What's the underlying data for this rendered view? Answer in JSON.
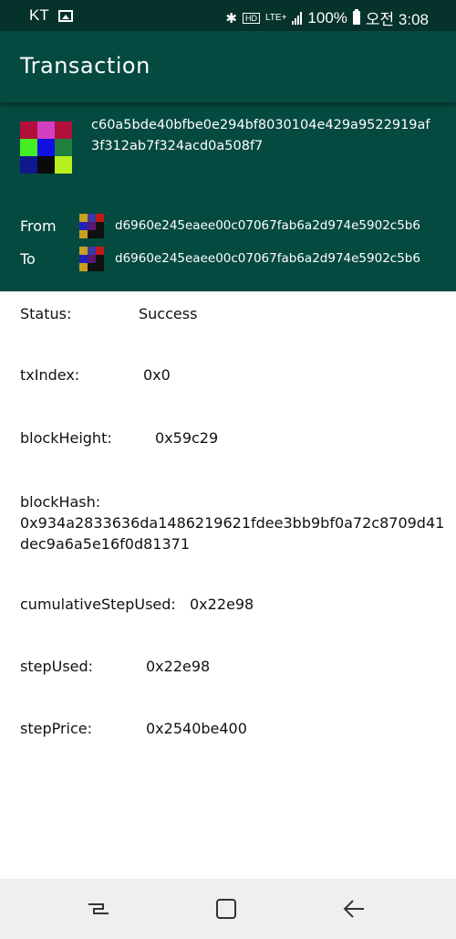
{
  "status_bar": {
    "carrier": "KT",
    "hd_label": "HD",
    "lte_label": "LTE+",
    "battery": "100%",
    "time": "오전 3:08",
    "icons": [
      "image-icon",
      "bluetooth-icon",
      "hd-icon",
      "lte-icon",
      "signal-icon",
      "battery-icon"
    ]
  },
  "app_bar": {
    "title": "Transaction"
  },
  "header": {
    "tx_hash": "c60a5bde40bfbe0e294bf8030104e429a9522919af3f312ab7f324acd0a508f7",
    "tx_identicon": [
      "#b0103a",
      "#d040c0",
      "#b0103a",
      "#44ee22",
      "#1010e0",
      "#208040",
      "#101890",
      "#0a0a0a",
      "#b8f020"
    ],
    "from_label": "From",
    "from_address": "d6960e245eaee00c07067fab6a2d974e5902c5b6",
    "to_label": "To",
    "to_address": "d6960e245eaee00c07067fab6a2d974e5902c5b6",
    "address_identicon": [
      "#c8a020",
      "#3a3aa0",
      "#c01818",
      "#2020c0",
      "#5a1870",
      "#101010",
      "#c8a020",
      "#101010",
      "#101010"
    ]
  },
  "details": {
    "status": {
      "label": "Status:",
      "value": "Success"
    },
    "tx_index": {
      "label": "txIndex:",
      "value": "0x0"
    },
    "block_height": {
      "label": "blockHeight:",
      "value": "0x59c29"
    },
    "block_hash": {
      "label": "blockHash:",
      "value": "0x934a2833636da1486219621fdee3bb9bf0a72c8709d41dec9a6a5e16f0d81371"
    },
    "cumulative_step_used": {
      "label": "cumulativeStepUsed:",
      "value": "0x22e98"
    },
    "step_used": {
      "label": "stepUsed:",
      "value": "0x22e98"
    },
    "step_price": {
      "label": "stepPrice:",
      "value": "0x2540be400"
    }
  },
  "nav_bar": {
    "buttons": [
      "recent-apps-icon",
      "home-icon",
      "back-icon"
    ]
  }
}
